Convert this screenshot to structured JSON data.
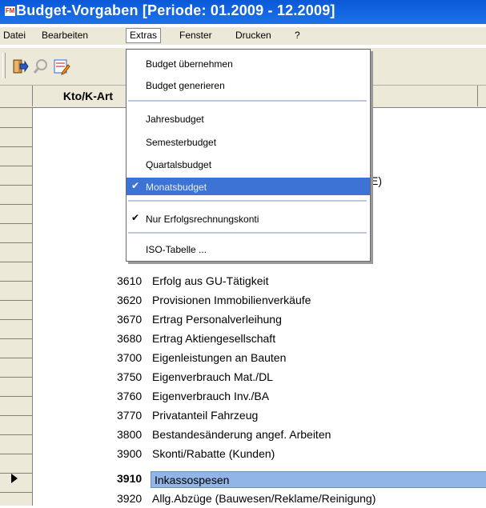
{
  "window": {
    "title": "Budget-Vorgaben  [Periode: 01.2009 - 12.2009]",
    "icon_text": "FM"
  },
  "menubar": {
    "items": [
      "Datei",
      "Bearbeiten",
      "Extras",
      "Fenster",
      "Drucken",
      "?"
    ]
  },
  "grid": {
    "header": {
      "kto": "Kto/K-Art",
      "dot": "."
    },
    "rows": [
      {
        "num": "3610",
        "desc": "Erfolg aus GU-Tätigkeit"
      },
      {
        "num": "3620",
        "desc": "Provisionen Immobilienverkäufe"
      },
      {
        "num": "3670",
        "desc": "Ertrag Personalverleihung"
      },
      {
        "num": "3680",
        "desc": "Ertrag Aktiengesellschaft"
      },
      {
        "num": "3700",
        "desc": "Eigenleistungen an Bauten"
      },
      {
        "num": "3750",
        "desc": "Eigenverbrauch Mat./DL"
      },
      {
        "num": "3760",
        "desc": "Eigenverbrauch Inv./BA"
      },
      {
        "num": "3770",
        "desc": "Privatanteil Fahrzeug"
      },
      {
        "num": "3800",
        "desc": "Bestandesänderung angef. Arbeiten"
      },
      {
        "num": "3900",
        "desc": "Skonti/Rabatte (Kunden)"
      },
      {
        "num": "3910",
        "desc": "Inkassospesen"
      },
      {
        "num": "3920",
        "desc": "Allg.Abzüge (Bauwesen/Reklame/Reinigung)"
      }
    ],
    "partial_text": "E)"
  },
  "extras_menu": {
    "items": [
      {
        "label": "Budget übernehmen"
      },
      {
        "label": "Budget generieren"
      },
      {
        "label": "Jahresbudget"
      },
      {
        "label": "Semesterbudget"
      },
      {
        "label": "Quartalsbudget"
      },
      {
        "label": "Monatsbudget",
        "checked": true,
        "highlighted": true
      },
      {
        "label": "Nur Erfolgsrechnungskonti",
        "checked": true
      },
      {
        "label": "ISO-Tabelle ..."
      }
    ]
  },
  "colors": {
    "titlebar": "#0a58d6",
    "menu_highlight": "#3d73d4",
    "row_selection": "#91b5e6"
  },
  "icons": [
    "exit-icon",
    "search-icon",
    "edit-icon",
    "checkmark-icon",
    "row-pointer-icon"
  ]
}
